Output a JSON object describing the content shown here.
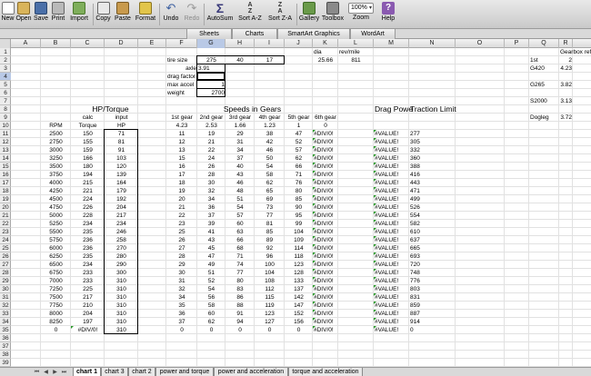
{
  "toolbar": {
    "new": "New",
    "open": "Open",
    "save": "Save",
    "print": "Print",
    "import": "Import",
    "copy": "Copy",
    "paste": "Paste",
    "format": "Format",
    "undo": "Undo",
    "redo": "Redo",
    "autosum": "AutoSum",
    "sort_az": "Sort A-Z",
    "sort_za": "Sort Z-A",
    "gallery": "Gallery",
    "toolbox": "Toolbox",
    "zoom_label": "Zoom",
    "zoom_value": "100%",
    "help": "Help"
  },
  "icons": {
    "new": "new-icon",
    "open": "open-icon",
    "save": "save-icon",
    "print": "print-icon",
    "import": "import-icon",
    "copy": "copy-icon",
    "paste": "paste-icon",
    "format": "format-icon",
    "undo": "undo-icon",
    "redo": "redo-icon",
    "autosum": "sigma-icon",
    "sort": "sort-icon",
    "gallery": "gallery-icon",
    "toolbox": "toolbox-icon",
    "help": "help-icon"
  },
  "ribbon": {
    "tabs": [
      "Sheets",
      "Charts",
      "SmartArt Graphics",
      "WordArt"
    ]
  },
  "columns": [
    "A",
    "B",
    "C",
    "D",
    "E",
    "F",
    "G",
    "H",
    "I",
    "J",
    "K",
    "L",
    "M",
    "N",
    "O",
    "P",
    "Q",
    "R"
  ],
  "selected_column": "G",
  "selected_row": 4,
  "rows": [
    1,
    2,
    3,
    4,
    5,
    6,
    7,
    8,
    9,
    10,
    11,
    12,
    13,
    14,
    15,
    16,
    17,
    18,
    19,
    20,
    21,
    22,
    23,
    24,
    25,
    26,
    27,
    28,
    29,
    30,
    31,
    32,
    33,
    34,
    35,
    36,
    37,
    38,
    39,
    40,
    41
  ],
  "inputs": {
    "dia_label": "dia",
    "dia_value": "25.66",
    "revmile_label": "rev/mile",
    "revmile_value": "811",
    "tire_size_label": "tire size",
    "tire_size": [
      "275",
      "40",
      "17"
    ],
    "axle_label": "axle",
    "axle_value": "3.91",
    "drag_factor_label": "drag factor",
    "max_accel_label": "max accel",
    "max_accel_value": "1",
    "weight_label": "weight",
    "weight_value": "2700"
  },
  "gearbox": {
    "header": "Gearbox refe",
    "subheader": "1st",
    "subheader2": "2",
    "entries": [
      {
        "name": "G420",
        "value": "4.23"
      },
      {
        "name": "G265",
        "value": "3.82"
      },
      {
        "name": "S2000",
        "value": "3.13"
      },
      {
        "name": "Dogleg",
        "value": "3.72"
      }
    ]
  },
  "hp_torque": {
    "title": "HP/Torque",
    "calc_label": "calc",
    "input_label": "input",
    "headers": [
      "RPM",
      "Torque",
      "HP"
    ]
  },
  "speeds": {
    "title": "Speeds in Gears",
    "gears": [
      "1st gear",
      "2nd gear",
      "3rd gear",
      "4th gear",
      "5th gear",
      "6th gear"
    ],
    "ratios": [
      "4.23",
      "2.53",
      "1.66",
      "1.23",
      "1",
      "0"
    ]
  },
  "drag_title": "Drag Powe",
  "traction_title": "Traction Limit",
  "table": [
    [
      "2500",
      "150",
      "71",
      "11",
      "19",
      "29",
      "38",
      "47",
      "#DIV/0!",
      "#VALUE!",
      "277"
    ],
    [
      "2750",
      "155",
      "81",
      "12",
      "21",
      "31",
      "42",
      "52",
      "#DIV/0!",
      "#VALUE!",
      "305"
    ],
    [
      "3000",
      "159",
      "91",
      "13",
      "22",
      "34",
      "46",
      "57",
      "#DIV/0!",
      "#VALUE!",
      "332"
    ],
    [
      "3250",
      "166",
      "103",
      "15",
      "24",
      "37",
      "50",
      "62",
      "#DIV/0!",
      "#VALUE!",
      "360"
    ],
    [
      "3500",
      "180",
      "120",
      "16",
      "26",
      "40",
      "54",
      "66",
      "#DIV/0!",
      "#VALUE!",
      "388"
    ],
    [
      "3750",
      "194",
      "139",
      "17",
      "28",
      "43",
      "58",
      "71",
      "#DIV/0!",
      "#VALUE!",
      "416"
    ],
    [
      "4000",
      "215",
      "164",
      "18",
      "30",
      "46",
      "62",
      "76",
      "#DIV/0!",
      "#VALUE!",
      "443"
    ],
    [
      "4250",
      "221",
      "179",
      "19",
      "32",
      "48",
      "65",
      "80",
      "#DIV/0!",
      "#VALUE!",
      "471"
    ],
    [
      "4500",
      "224",
      "192",
      "20",
      "34",
      "51",
      "69",
      "85",
      "#DIV/0!",
      "#VALUE!",
      "499"
    ],
    [
      "4750",
      "226",
      "204",
      "21",
      "36",
      "54",
      "73",
      "90",
      "#DIV/0!",
      "#VALUE!",
      "526"
    ],
    [
      "5000",
      "228",
      "217",
      "22",
      "37",
      "57",
      "77",
      "95",
      "#DIV/0!",
      "#VALUE!",
      "554"
    ],
    [
      "5250",
      "234",
      "234",
      "23",
      "39",
      "60",
      "81",
      "99",
      "#DIV/0!",
      "#VALUE!",
      "582"
    ],
    [
      "5500",
      "235",
      "246",
      "25",
      "41",
      "63",
      "85",
      "104",
      "#DIV/0!",
      "#VALUE!",
      "610"
    ],
    [
      "5750",
      "236",
      "258",
      "26",
      "43",
      "66",
      "89",
      "109",
      "#DIV/0!",
      "#VALUE!",
      "637"
    ],
    [
      "6000",
      "236",
      "270",
      "27",
      "45",
      "68",
      "92",
      "114",
      "#DIV/0!",
      "#VALUE!",
      "665"
    ],
    [
      "6250",
      "235",
      "280",
      "28",
      "47",
      "71",
      "96",
      "118",
      "#DIV/0!",
      "#VALUE!",
      "693"
    ],
    [
      "6500",
      "234",
      "290",
      "29",
      "49",
      "74",
      "100",
      "123",
      "#DIV/0!",
      "#VALUE!",
      "720"
    ],
    [
      "6750",
      "233",
      "300",
      "30",
      "51",
      "77",
      "104",
      "128",
      "#DIV/0!",
      "#VALUE!",
      "748"
    ],
    [
      "7000",
      "233",
      "310",
      "31",
      "52",
      "80",
      "108",
      "133",
      "#DIV/0!",
      "#VALUE!",
      "776"
    ],
    [
      "7250",
      "225",
      "310",
      "32",
      "54",
      "83",
      "112",
      "137",
      "#DIV/0!",
      "#VALUE!",
      "803"
    ],
    [
      "7500",
      "217",
      "310",
      "34",
      "56",
      "86",
      "115",
      "142",
      "#DIV/0!",
      "#VALUE!",
      "831"
    ],
    [
      "7750",
      "210",
      "310",
      "35",
      "58",
      "88",
      "119",
      "147",
      "#DIV/0!",
      "#VALUE!",
      "859"
    ],
    [
      "8000",
      "204",
      "310",
      "36",
      "60",
      "91",
      "123",
      "152",
      "#DIV/0!",
      "#VALUE!",
      "887"
    ],
    [
      "8250",
      "197",
      "310",
      "37",
      "62",
      "94",
      "127",
      "156",
      "#DIV/0!",
      "#VALUE!",
      "914"
    ],
    [
      "0",
      "#DIV/0!",
      "310",
      "0",
      "0",
      "0",
      "0",
      "0",
      "#DIV/0!",
      "#VALUE!",
      "0"
    ]
  ],
  "sheet_tabs": [
    "chart 1",
    "chart 3",
    "chart 2",
    "power and torque",
    "power and acceleration",
    "torque and acceleration"
  ],
  "active_sheet": "chart 1",
  "colors": {
    "toolbar": "#d4d4d4",
    "selection": "#b9c9e6",
    "error_marker": "#2a9a2a"
  }
}
